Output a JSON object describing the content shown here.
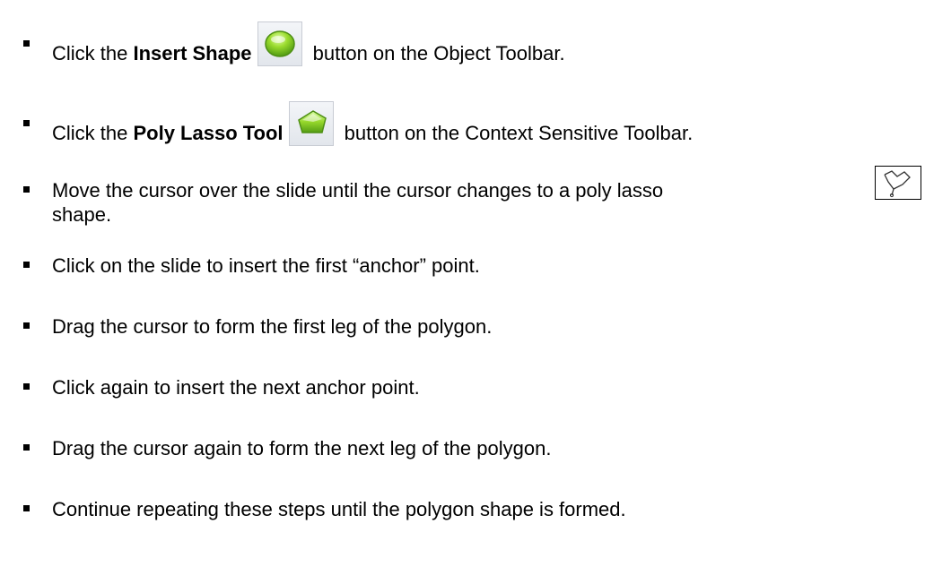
{
  "steps": [
    {
      "before": "Click the ",
      "bold": "Insert Shape",
      "after": " button on the Object Toolbar.",
      "icon": "insert-shape-icon"
    },
    {
      "before": "Click the ",
      "bold": "Poly Lasso Tool",
      "after": " button on the Context Sensitive Toolbar.",
      "icon": "poly-lasso-tool-icon"
    },
    {
      "line1": "Move the cursor over the slide until the cursor changes to a poly lasso",
      "line2": "shape.",
      "icon": "poly-lasso-cursor-icon"
    },
    {
      "text": "Click on the slide to insert the first “anchor” point."
    },
    {
      "text": "Drag the cursor to form the first leg of the polygon."
    },
    {
      "text": "Click again to insert the next anchor point."
    },
    {
      "text": "Drag the cursor again to form the next leg of the polygon."
    },
    {
      "text": "Continue repeating these steps until the polygon shape is formed."
    }
  ],
  "colors": {
    "text": "#000000",
    "icon_green": "#8fd62a",
    "icon_green_dark": "#5aa516",
    "button_border": "#c8ccd4"
  }
}
